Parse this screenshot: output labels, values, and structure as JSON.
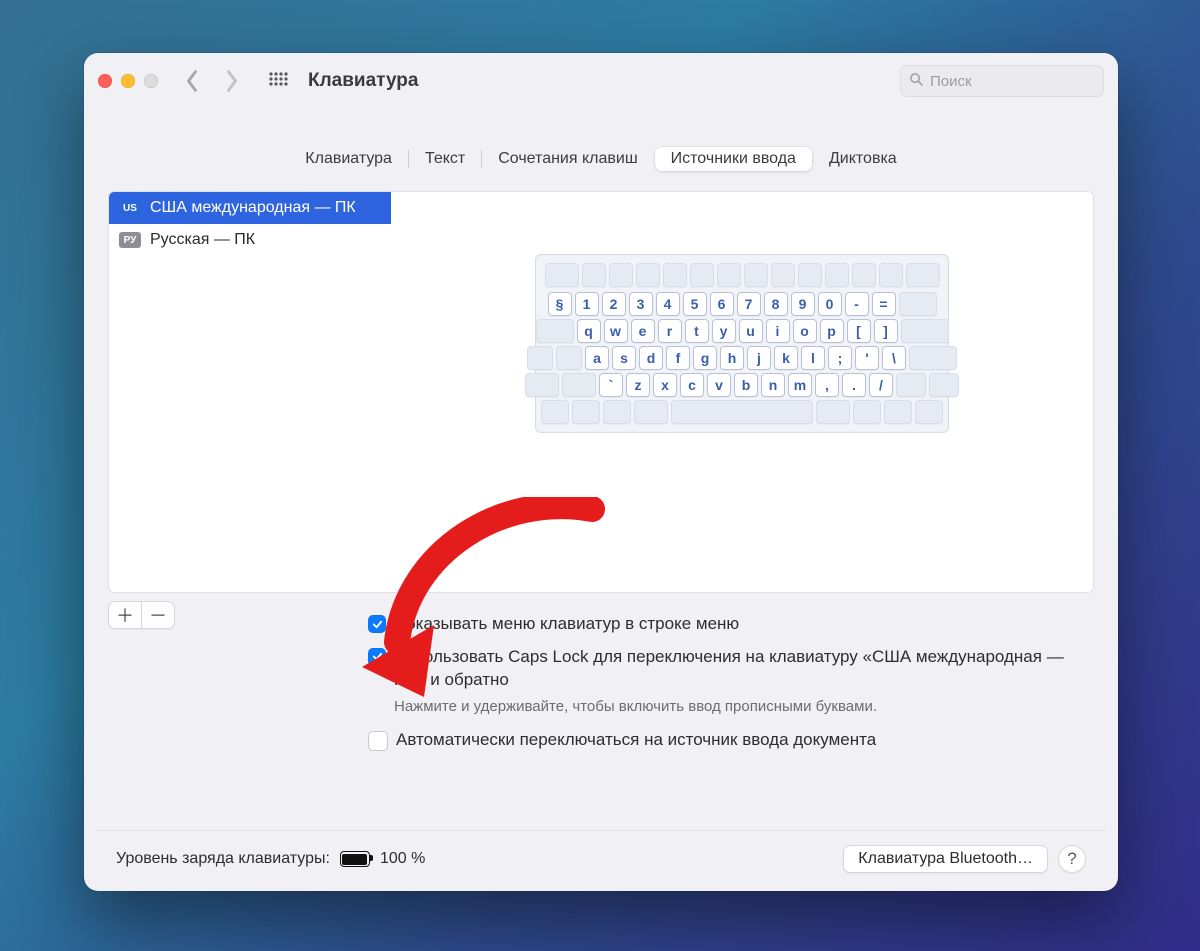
{
  "window": {
    "title": "Клавиатура"
  },
  "search": {
    "placeholder": "Поиск"
  },
  "tabs": [
    {
      "label": "Клавиатура",
      "active": false
    },
    {
      "label": "Текст",
      "active": false
    },
    {
      "label": "Сочетания клавиш",
      "active": false
    },
    {
      "label": "Источники ввода",
      "active": true
    },
    {
      "label": "Диктовка",
      "active": false
    }
  ],
  "sources": [
    {
      "flag": "US",
      "label": "США международная — ПК",
      "selected": true
    },
    {
      "flag": "РУ",
      "label": "Русская — ПК",
      "selected": false
    }
  ],
  "keyboard_rows": [
    [
      "§",
      "1",
      "2",
      "3",
      "4",
      "5",
      "6",
      "7",
      "8",
      "9",
      "0",
      "-",
      "="
    ],
    [
      "q",
      "w",
      "e",
      "r",
      "t",
      "y",
      "u",
      "i",
      "o",
      "p",
      "[",
      "]"
    ],
    [
      "a",
      "s",
      "d",
      "f",
      "g",
      "h",
      "j",
      "k",
      "l",
      ";",
      "'",
      "\\"
    ],
    [
      "`",
      "z",
      "x",
      "c",
      "v",
      "b",
      "n",
      "m",
      ",",
      ".",
      "/"
    ]
  ],
  "options": {
    "show_menu": {
      "checked": true,
      "label": "Показывать меню клавиатур в строке меню"
    },
    "capslock": {
      "checked": true,
      "label": "Использовать Caps Lock для переключения на клавиатуру «США международная — ПК» и обратно",
      "hint": "Нажмите и удерживайте, чтобы включить ввод прописными буквами."
    },
    "auto": {
      "checked": false,
      "label": "Автоматически переключаться на источник ввода документа"
    }
  },
  "footer": {
    "battery_label": "Уровень заряда клавиатуры:",
    "battery_pct": "100 %",
    "bluetooth_btn": "Клавиатура Bluetooth…"
  }
}
